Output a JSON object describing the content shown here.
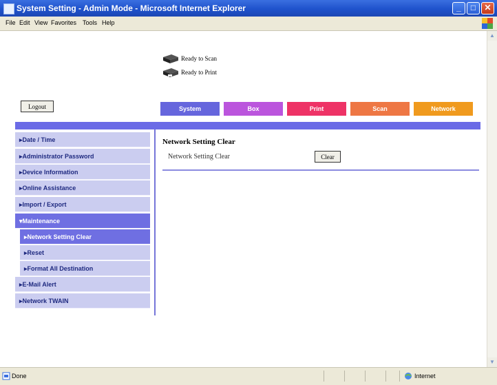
{
  "window": {
    "title": "System Setting - Admin Mode - Microsoft Internet Explorer",
    "minimize_symbol": "_",
    "maximize_symbol": "□",
    "close_symbol": "✕"
  },
  "menu": [
    "File",
    "Edit",
    "View",
    "Favorites",
    "Tools",
    "Help"
  ],
  "device_status": {
    "scan": "Ready to Scan",
    "print": "Ready to Print"
  },
  "logout_label": "Logout",
  "tabs": [
    {
      "label": "System",
      "color": "#6666dd"
    },
    {
      "label": "Box",
      "color": "#bb55dd"
    },
    {
      "label": "Print",
      "color": "#ee3366"
    },
    {
      "label": "Scan",
      "color": "#ee7744"
    },
    {
      "label": "Network",
      "color": "#f09a1e"
    }
  ],
  "sidebar": [
    {
      "label": "Date / Time",
      "prefix": "▸"
    },
    {
      "label": "Administrator Password",
      "prefix": "▸"
    },
    {
      "label": "Device Information",
      "prefix": "▸"
    },
    {
      "label": "Online Assistance",
      "prefix": "▸"
    },
    {
      "label": "Import / Export",
      "prefix": "▸"
    },
    {
      "label": "Maintenance",
      "prefix": "▾"
    },
    {
      "label": "Network Setting Clear",
      "prefix": "▸"
    },
    {
      "label": "Reset",
      "prefix": "▸"
    },
    {
      "label": "Format All Destination",
      "prefix": "▸"
    },
    {
      "label": "E-Mail Alert",
      "prefix": "▸"
    },
    {
      "label": "Network TWAIN",
      "prefix": "▸"
    }
  ],
  "main": {
    "heading": "Network Setting Clear",
    "setting_label": "Network Setting Clear",
    "clear_label": "Clear"
  },
  "statusbar": {
    "left": "Done",
    "zone": "Internet"
  },
  "scroll": {
    "up_symbol": "▲",
    "down_symbol": "▼"
  }
}
